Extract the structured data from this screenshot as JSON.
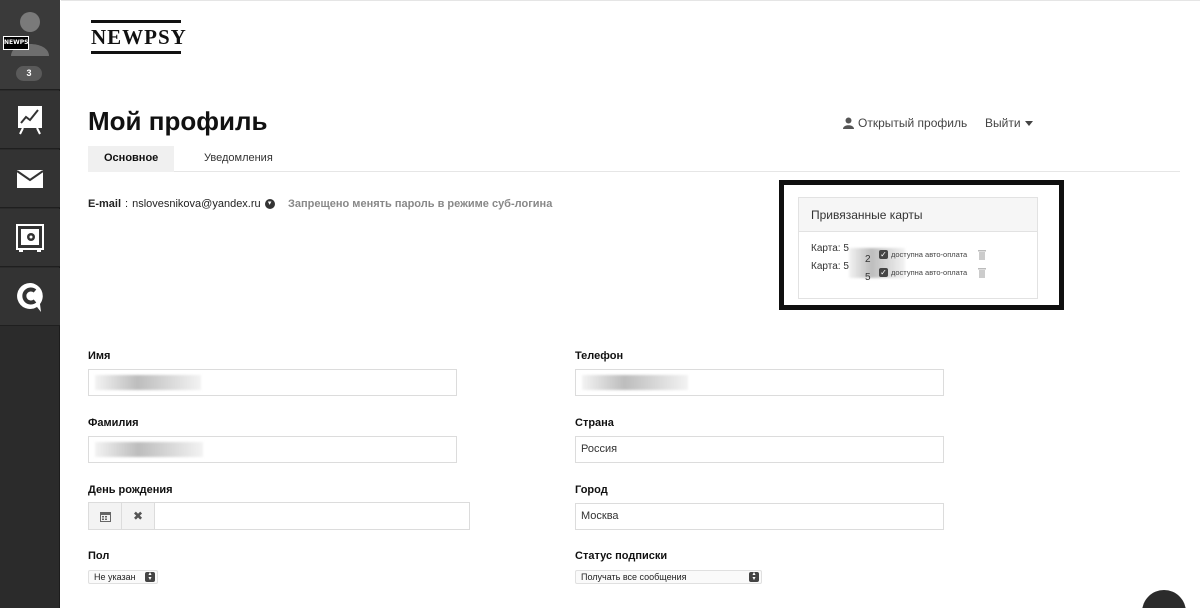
{
  "sidebar": {
    "avatar_tag": "NEWPSY",
    "badge_count": "3",
    "items": [
      {
        "icon": "chart-icon"
      },
      {
        "icon": "mail-icon"
      },
      {
        "icon": "safe-icon"
      },
      {
        "icon": "chat-c-icon"
      }
    ]
  },
  "header": {
    "logo": "NEWPSY",
    "title": "Мой профиль",
    "open_profile": "Открытый профиль",
    "logout": "Выйти"
  },
  "tabs": [
    "Основное",
    "Уведомления"
  ],
  "account": {
    "email_label": "E-mail",
    "email": "nslovesnikova@yandex.ru",
    "note": "Запрещено менять пароль в режиме суб-логина"
  },
  "cards": {
    "title": "Привязанные карты",
    "items": [
      {
        "label": "Карта: 5",
        "suffix": "2",
        "auto": "доступна авто-оплата"
      },
      {
        "label": "Карта: 5",
        "suffix": "5",
        "auto": "доступна авто-оплата"
      }
    ]
  },
  "form": {
    "name_label": "Имя",
    "surname_label": "Фамилия",
    "birthday_label": "День рождения",
    "gender_label": "Пол",
    "gender_value": "Не указан",
    "phone_label": "Телефон",
    "country_label": "Страна",
    "country_value": "Россия",
    "city_label": "Город",
    "city_value": "Москва",
    "subscription_label": "Статус подписки",
    "subscription_value": "Получать все сообщения"
  },
  "colors": {
    "sidebar_bg": "#2b2b2b",
    "text": "#222222",
    "muted": "#888888"
  }
}
